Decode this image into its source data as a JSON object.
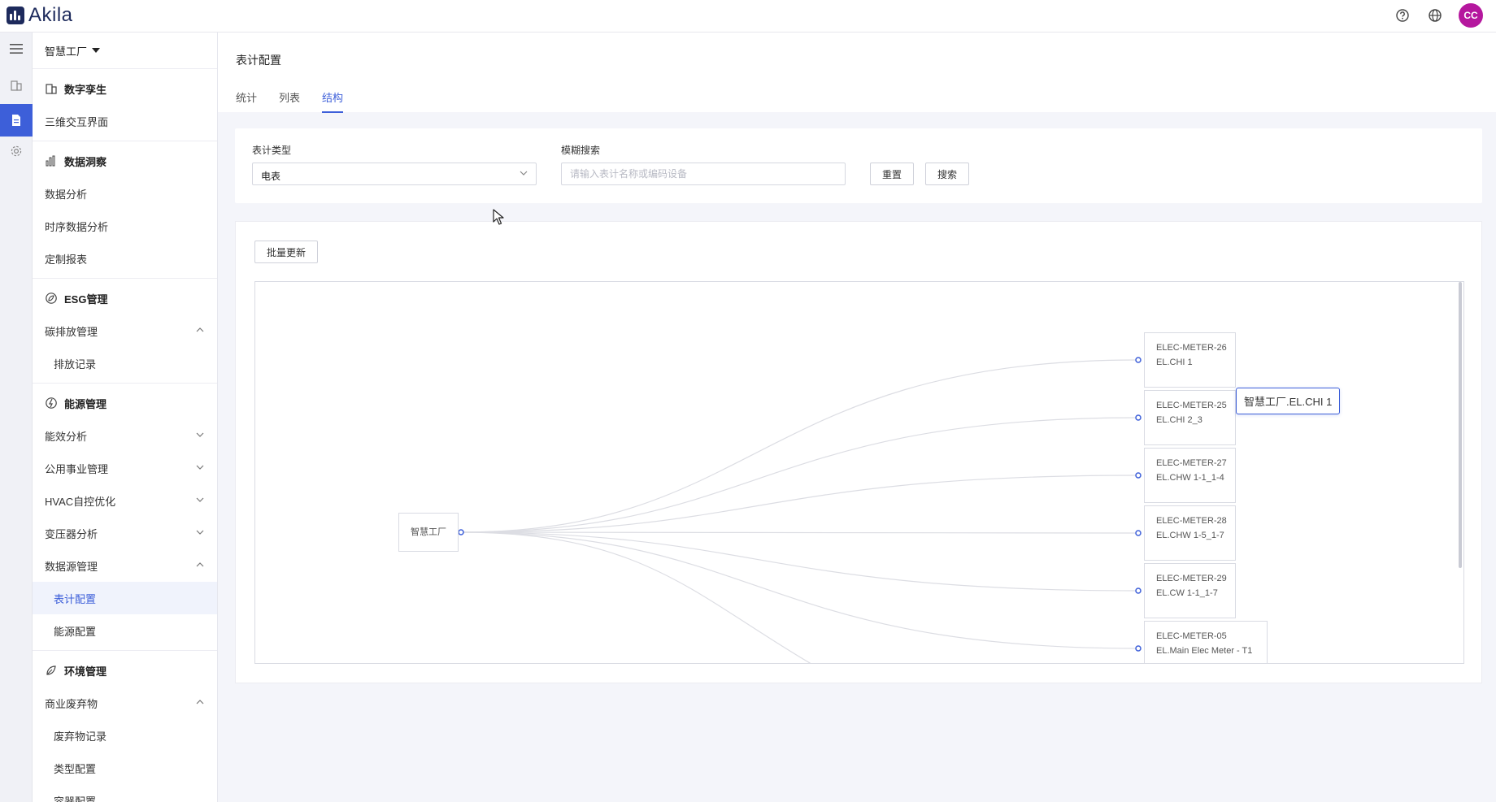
{
  "app": {
    "name": "Akila"
  },
  "header_icons": [
    "help-icon",
    "globe-icon"
  ],
  "user": {
    "initials": "CC",
    "avatar_color": "#b5179e"
  },
  "accent_color": "#3d5fd9",
  "rail": [
    "menu-icon",
    "building-icon",
    "document-icon",
    "gear-icon"
  ],
  "sidebar": {
    "org": "智慧工厂",
    "groups": [
      {
        "title": "数字孪生",
        "icon": "building-icon",
        "items": [
          {
            "label": "三维交互界面"
          }
        ]
      },
      {
        "title": "数据洞察",
        "icon": "bar-chart-icon",
        "items": [
          {
            "label": "数据分析"
          },
          {
            "label": "时序数据分析"
          },
          {
            "label": "定制报表"
          }
        ]
      },
      {
        "title": "ESG管理",
        "icon": "globe-leaf-icon",
        "items": [
          {
            "label": "碳排放管理",
            "chevron": "up"
          },
          {
            "label": "排放记录",
            "sub": true
          }
        ]
      },
      {
        "title": "能源管理",
        "icon": "energy-icon",
        "items": [
          {
            "label": "能效分析",
            "chevron": "down"
          },
          {
            "label": "公用事业管理",
            "chevron": "down"
          },
          {
            "label": "HVAC自控优化",
            "chevron": "down"
          },
          {
            "label": "变压器分析",
            "chevron": "down"
          },
          {
            "label": "数据源管理",
            "chevron": "up"
          },
          {
            "label": "表计配置",
            "sub": true,
            "active": true
          },
          {
            "label": "能源配置",
            "sub": true
          }
        ]
      },
      {
        "title": "环境管理",
        "icon": "leaf-icon",
        "items": [
          {
            "label": "商业废弃物",
            "chevron": "up"
          },
          {
            "label": "废弃物记录",
            "sub": true
          },
          {
            "label": "类型配置",
            "sub": true
          },
          {
            "label": "容器配置",
            "sub": true
          }
        ]
      }
    ]
  },
  "page": {
    "title": "表计配置",
    "tabs": [
      {
        "label": "统计"
      },
      {
        "label": "列表"
      },
      {
        "label": "结构",
        "active": true
      }
    ]
  },
  "filters": {
    "meter_type_label": "表计类型",
    "meter_type_value": "电表",
    "search_label": "模糊搜索",
    "search_placeholder": "请输入表计名称或编码设备",
    "reset_label": "重置",
    "search_button": "搜索"
  },
  "batch_update_label": "批量更新",
  "tree": {
    "root": "智慧工厂",
    "nodes": [
      {
        "code": "ELEC-METER-26",
        "name": "EL.CHI 1"
      },
      {
        "code": "ELEC-METER-25",
        "name": "EL.CHI 2_3"
      },
      {
        "code": "ELEC-METER-27",
        "name": "EL.CHW 1-1_1-4"
      },
      {
        "code": "ELEC-METER-28",
        "name": "EL.CHW 1-5_1-7"
      },
      {
        "code": "ELEC-METER-29",
        "name": "EL.CW 1-1_1-7"
      },
      {
        "code": "ELEC-METER-05",
        "name": "EL.Main Elec Meter - T1"
      }
    ],
    "tooltip": "智慧工厂.EL.CHI 1"
  }
}
